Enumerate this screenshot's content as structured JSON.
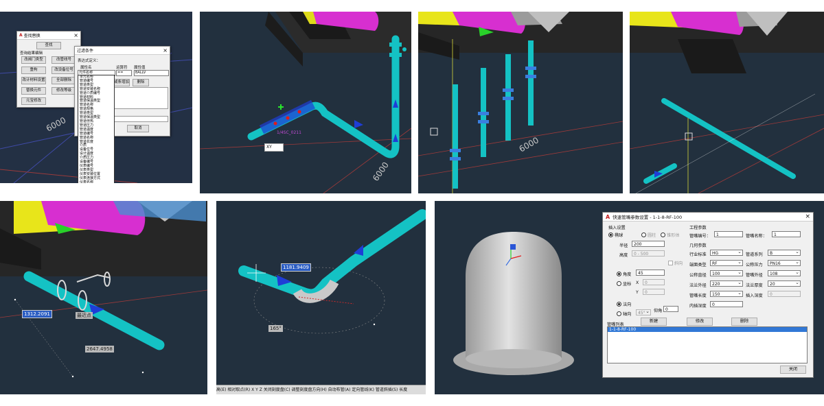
{
  "panel1": {
    "dialog_main": {
      "title": "查找替换",
      "find": "查找",
      "section": "查询结果编辑",
      "buttons": [
        "改阀门类型",
        "改管线号",
        "重构",
        "改设备位号",
        "改计材料设置",
        "全部删除",
        "替换元件",
        "修改等级",
        "元宝修改"
      ]
    },
    "dialog_filter": {
      "title": "过滤条件",
      "expr_label": "表达式定义：",
      "col_attr": "属性名",
      "col_op": "运算符",
      "col_val": "属性值",
      "attr_selected": "元件名称",
      "op_selected": "==",
      "val_selected": "BALLV",
      "btn_add": "或条增加",
      "btn_delete": "删除",
      "btn_cancel": "取消",
      "dropdown_items": [
        "单元名称",
        "管道编号",
        "管道类型",
        "管道安装名称",
        "管道介质编号",
        "管道材料",
        "管道保温类型",
        "管道名称",
        "管道规格",
        "管道类型",
        "管道保温类型",
        "管道伴热",
        "管道压力",
        "管道温度",
        "管道编号",
        "管道名称",
        "管道长度",
        "介质",
        "设备位号",
        "设计温度",
        "介质压力",
        "设备编号",
        "仪表编号",
        "仪表类型",
        "仪表安装位置",
        "仪表连接方式",
        "仪表名称",
        "仪表规格",
        "元件名称",
        "元件尺寸",
        "元件代码",
        "元件描述",
        "安装类型",
        "安装方式",
        "重量"
      ],
      "highlight_index": 28
    },
    "dimension": "6000"
  },
  "panel2": {
    "pipe_label": "1/4SC_0211",
    "input_value": "XY",
    "dimension": "6000"
  },
  "panel3": {
    "dimension": "6000"
  },
  "panel5": {
    "dim_input": "1312.2091",
    "snap_tip": "最近点",
    "dim_length": "2647.4958"
  },
  "panel6": {
    "dim_input": "1181.9409",
    "angle": "165°",
    "command_bar": "高(E) 相对取点(R) X Y Z 关闭刻度盘(C) 调整刻度盘方向(H) 自动布管(A) 定向管线(K) 管道斜插(S) 长度"
  },
  "panel7": {
    "dialog": {
      "title": "快速管嘴参数设置 - 1-1-8-RF-100",
      "insert_section": "插入设置",
      "shapes": [
        "椭球",
        "圆柱",
        "锥形体"
      ],
      "radius_label": "半径",
      "radius_value": "200",
      "height_label": "高度",
      "height_value": "0 - 500",
      "tilt_label": "斜向",
      "angle_label": "角度",
      "angle_value": "45",
      "coord_label": "坐标",
      "x_label": "X",
      "x_value": "0",
      "y_label": "Y",
      "y_value": "0",
      "normal_label": "法向",
      "axial_label": "轴向",
      "axial_value": "45°",
      "elevation_label": "仰角",
      "elevation_value": "0",
      "engineering_section": "工程参数",
      "nozzle_no_label": "管嘴编号：",
      "nozzle_no_value": "1",
      "nozzle_name_label": "管嘴名称：",
      "nozzle_name_value": "1",
      "geometry_section": "几何参数",
      "standard_label": "行业标准",
      "standard_value": "HG",
      "series_label": "管道系列",
      "series_value": "B",
      "face_label": "端面类型",
      "face_value": "RF",
      "pressure_label": "公称压力",
      "pressure_value": "PN16",
      "dn_label": "公称直径",
      "dn_value": "100",
      "od_label": "管嘴外径",
      "od_value": "108",
      "flange_od_label": "法兰外径",
      "flange_od_value": "220",
      "flange_th_label": "法兰厚度",
      "flange_th_value": "20",
      "length_label": "管嘴长度",
      "length_value": "150",
      "insert_depth_label": "插入深度",
      "insert_depth_value": "0",
      "inner_depth_label": "内插深度",
      "inner_depth_value": "0",
      "list_label": "管嘴列表",
      "btn_new": "新建",
      "btn_modify": "修改",
      "btn_delete": "删除",
      "list_items": [
        "1-1-8-RF-100"
      ],
      "btn_close": "关闭"
    }
  },
  "colors": {
    "viewport_bg": "#24303f",
    "pipe_cyan": "#14c2c4",
    "pipe_yellow": "#e8e51a",
    "pipe_magenta": "#d72fd0",
    "flow_arrow": "#1f3dd6",
    "valve_blue": "#3a7fe0",
    "tank_gray": "#bdbdbd"
  }
}
